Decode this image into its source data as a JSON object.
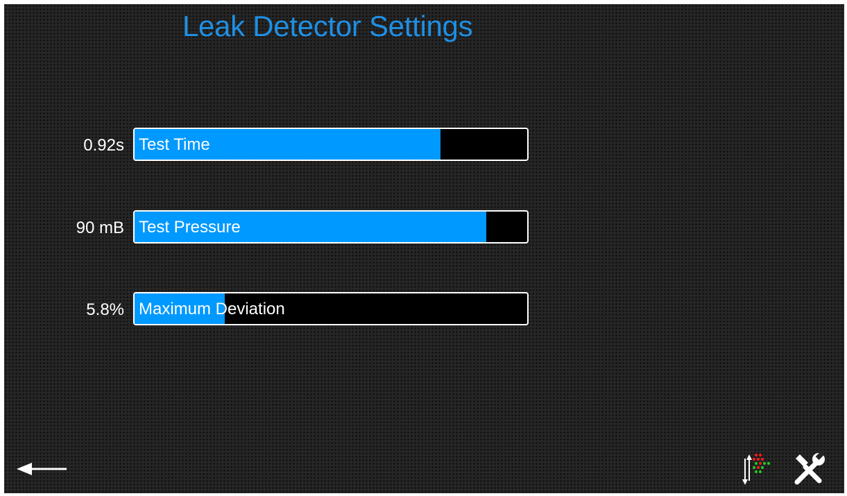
{
  "header": {
    "title": "Leak Detector Settings"
  },
  "settings": [
    {
      "label": "Test Time",
      "value": "0.92s",
      "level_percent": 78
    },
    {
      "label": "Test Pressure",
      "value": "90 mB",
      "level_percent": 89.5
    },
    {
      "label": "Maximum Deviation",
      "value": "5.8%",
      "level_percent": 23
    }
  ],
  "footer": {
    "back_icon": "left-arrow-icon",
    "io_icon": "io-status-icon",
    "tools_icon": "tools-icon"
  },
  "colors": {
    "title": "#1f8fe3",
    "bar_fill": "#0099ff",
    "bar_border": "#ffffff",
    "bar_background": "#000000",
    "background": "#262626"
  }
}
